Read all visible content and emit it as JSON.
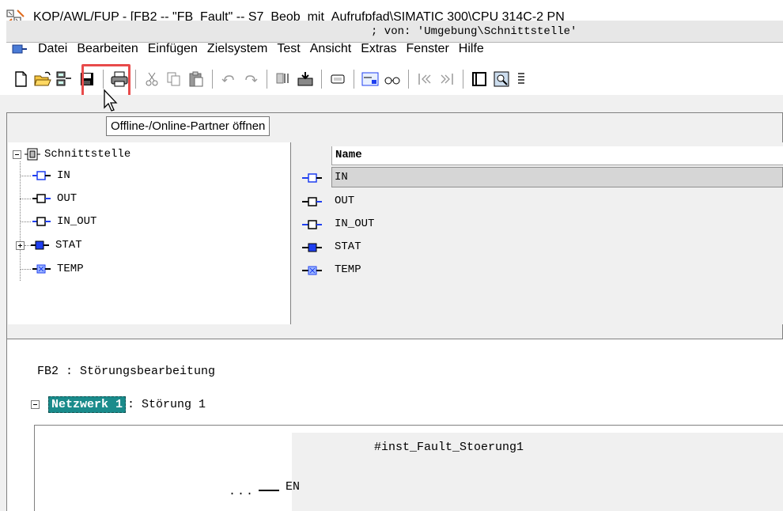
{
  "window": {
    "title": "KOP/AWL/FUP  - [FB2 -- \"FB_Fault\" -- S7_Beob_mit_Aufrufpfad\\SIMATIC 300\\CPU 314C-2 PN"
  },
  "menubar": {
    "items": [
      "Datei",
      "Bearbeiten",
      "Einfügen",
      "Zielsystem",
      "Test",
      "Ansicht",
      "Extras",
      "Fenster",
      "Hilfe"
    ]
  },
  "toolbar": {
    "buttons": [
      "new-document-icon",
      "open-folder-icon",
      "online-partner-icon",
      "save-icon",
      "print-icon",
      "cut-icon",
      "copy-icon",
      "paste-icon",
      "undo-icon",
      "redo-icon",
      "accessible-nodes-icon",
      "download-icon",
      "module-status-icon",
      "network-icon",
      "glasses-icon",
      "previous-icon",
      "next-icon",
      "overview-icon",
      "zoom-icon",
      "details-icon"
    ],
    "tooltip": "Offline-/Online-Partner öffnen"
  },
  "interface_pane": {
    "header": "; von: 'Umgebung\\Schnittstelle'",
    "tree_root": "Schnittstelle",
    "tree_items": [
      "IN",
      "OUT",
      "IN_OUT",
      "STAT",
      "TEMP"
    ],
    "grid_header": "Name",
    "grid_rows": [
      "IN",
      "OUT",
      "IN_OUT",
      "STAT",
      "TEMP"
    ]
  },
  "editor": {
    "block_title": "FB2 : Störungsbearbeitung",
    "network_label": "Netzwerk 1",
    "network_title": ": Störung 1",
    "fb_instance": "#inst_Fault_Stoerung1",
    "en_dots": "...",
    "en_label": "EN"
  },
  "colors": {
    "highlight": "#e84b4b",
    "network_label_bg": "#1a8b8b",
    "decl_blue": "#1f3ff0"
  }
}
